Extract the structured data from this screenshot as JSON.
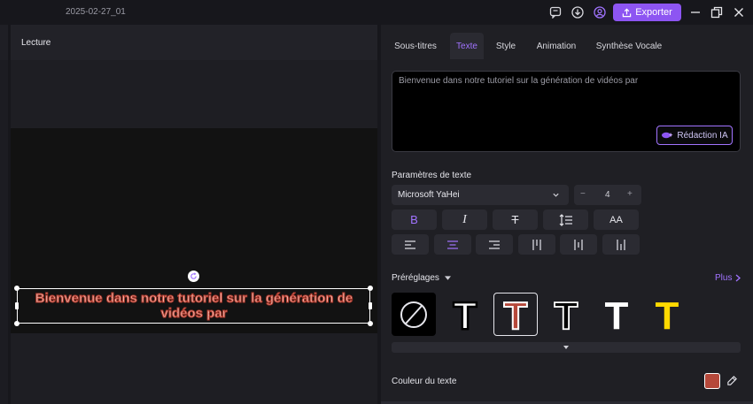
{
  "app": {
    "project_title": "2025-02-27_01",
    "export_label": "Exporter",
    "accent_color": "#8d55f2"
  },
  "topbar": {
    "icons": [
      "feedback-icon",
      "download-icon",
      "account-icon",
      "export-icon",
      "minimize-icon",
      "restore-icon",
      "close-icon"
    ]
  },
  "player": {
    "title": "Lecture",
    "caption": "Bienvenue dans notre tutoriel sur la génération de vidéos par"
  },
  "panel": {
    "tabs": [
      {
        "label": "Sous-titres",
        "active": false
      },
      {
        "label": "Texte",
        "active": true
      },
      {
        "label": "Style",
        "active": false
      },
      {
        "label": "Animation",
        "active": false
      },
      {
        "label": "Synthèse Vocale",
        "active": false
      }
    ],
    "text_value": "Bienvenue dans notre tutoriel sur la génération de vidéos par",
    "ai_button": "Rédaction IA",
    "text_params_label": "Paramètres de texte",
    "font_family": "Microsoft YaHei",
    "font_size": "4",
    "stepper_minus": "−",
    "stepper_plus": "+",
    "format_buttons": [
      {
        "name": "bold",
        "glyph": "B"
      },
      {
        "name": "italic",
        "glyph": "I"
      },
      {
        "name": "strikethrough",
        "glyph": "T"
      },
      {
        "name": "line-spacing",
        "glyph": ""
      },
      {
        "name": "uppercase",
        "glyph": "AA"
      }
    ],
    "align_buttons": [
      "align-left",
      "align-center",
      "align-right",
      "align-top",
      "align-middle",
      "align-bottom"
    ],
    "active_align": "align-center",
    "presets_label": "Préréglages",
    "more_label": "Plus",
    "presets": [
      {
        "name": "none",
        "glyph": ""
      },
      {
        "name": "white-black-outline",
        "glyph": "T",
        "fill": "#ffffff",
        "stroke": "#000000"
      },
      {
        "name": "brown-white-outline",
        "glyph": "T",
        "fill": "#b5483a",
        "stroke": "#ffffff",
        "selected": true
      },
      {
        "name": "black-white-outline",
        "glyph": "T",
        "fill": "#000000",
        "stroke": "#ffffff"
      },
      {
        "name": "white-plain",
        "glyph": "T",
        "fill": "#ffffff",
        "stroke": "#ffffff"
      },
      {
        "name": "yellow-plain",
        "glyph": "T",
        "fill": "#ffd900",
        "stroke": "#ffd900"
      }
    ],
    "text_color_label": "Couleur du texte",
    "text_color": "#b5483a"
  }
}
